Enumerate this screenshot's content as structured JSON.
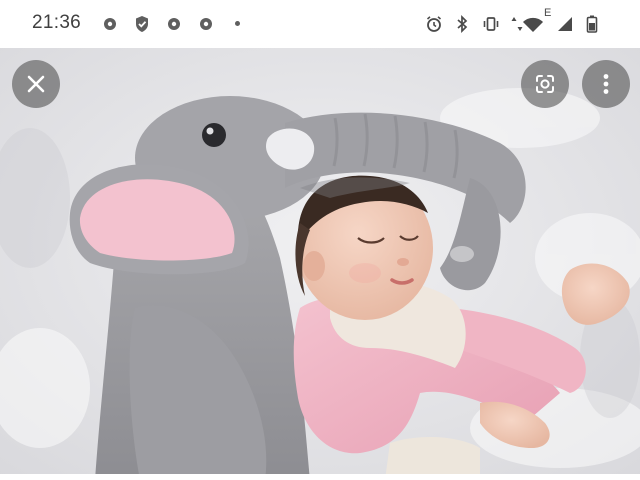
{
  "status_bar": {
    "time": "21:36",
    "network_label": "E",
    "left_icons": [
      "gear-icon",
      "shield-icon",
      "gear-icon",
      "gear-icon",
      "dot-icon"
    ],
    "right_icons": [
      "alarm-icon",
      "bluetooth-icon",
      "vibrate-icon",
      "data-arrows-icon",
      "wifi-icon",
      "signal-icon",
      "battery-icon"
    ]
  },
  "viewer": {
    "photo_subject": "baby-with-elephant-plush",
    "close_icon": "close-icon",
    "lens_icon": "lens-icon",
    "more_icon": "more-vert-icon"
  },
  "colors": {
    "status_bar_bg": "#ffffff",
    "status_text": "#404040",
    "overlay_button": "#464646"
  }
}
